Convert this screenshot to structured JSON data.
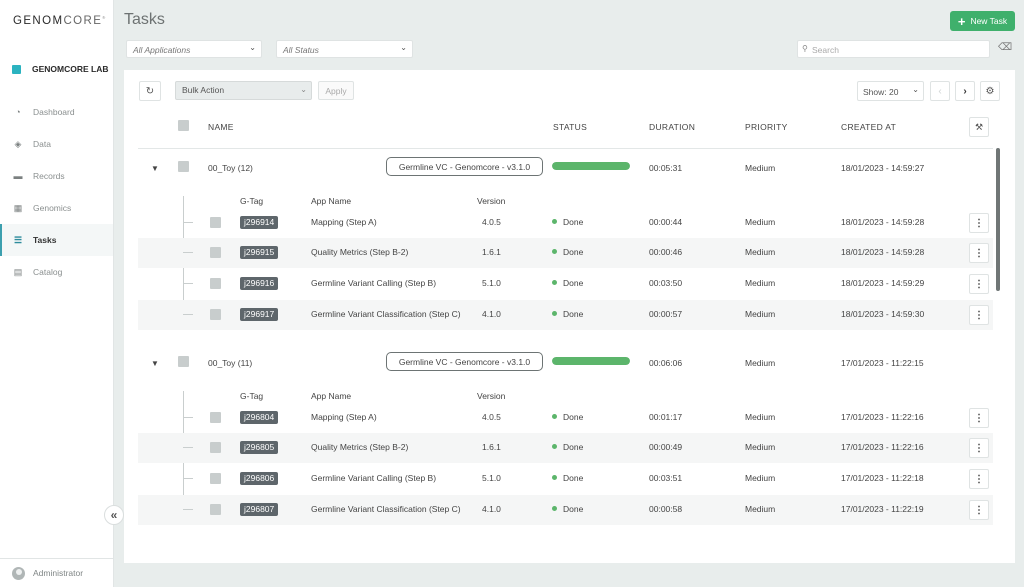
{
  "brand": {
    "logo_main": "GENOM",
    "logo_sub": "CORE",
    "logo_mark": "®",
    "lab": "GENOMCORE LAB"
  },
  "nav": [
    {
      "label": "Dashboard",
      "icon": "dashboard-icon"
    },
    {
      "label": "Data",
      "icon": "layers-icon"
    },
    {
      "label": "Records",
      "icon": "briefcase-icon"
    },
    {
      "label": "Genomics",
      "icon": "grid-icon"
    },
    {
      "label": "Tasks",
      "icon": "list-icon",
      "active": true
    },
    {
      "label": "Catalog",
      "icon": "catalog-icon"
    }
  ],
  "user": {
    "name": "Administrator"
  },
  "page": {
    "title": "Tasks",
    "new_task": "New Task"
  },
  "filters": {
    "applications": "All Applications",
    "status": "All Status",
    "search_placeholder": "Search"
  },
  "toolbar": {
    "bulk_action": "Bulk Action",
    "apply": "Apply",
    "show": "Show: 20"
  },
  "columns": {
    "name": "NAME",
    "status": "STATUS",
    "duration": "DURATION",
    "priority": "PRIORITY",
    "created_at": "CREATED AT"
  },
  "subcolumns": {
    "gtag": "G-Tag",
    "app_name": "App Name",
    "version": "Version"
  },
  "groups": [
    {
      "name": "00_Toy (12)",
      "workflow": "Germline VC - Genomcore - v3.1.0",
      "progress": 1.0,
      "duration": "00:05:31",
      "priority": "Medium",
      "created": "18/01/2023 - 14:59:27",
      "tasks": [
        {
          "tag": "j296914",
          "app": "Mapping (Step A)",
          "version": "4.0.5",
          "status": "Done",
          "duration": "00:00:44",
          "priority": "Medium",
          "created": "18/01/2023 - 14:59:28"
        },
        {
          "tag": "j296915",
          "app": "Quality Metrics (Step B-2)",
          "version": "1.6.1",
          "status": "Done",
          "duration": "00:00:46",
          "priority": "Medium",
          "created": "18/01/2023 - 14:59:28"
        },
        {
          "tag": "j296916",
          "app": "Germline Variant Calling (Step B)",
          "version": "5.1.0",
          "status": "Done",
          "duration": "00:03:50",
          "priority": "Medium",
          "created": "18/01/2023 - 14:59:29"
        },
        {
          "tag": "j296917",
          "app": "Germline Variant Classification (Step C)",
          "version": "4.1.0",
          "status": "Done",
          "duration": "00:00:57",
          "priority": "Medium",
          "created": "18/01/2023 - 14:59:30"
        }
      ]
    },
    {
      "name": "00_Toy (11)",
      "workflow": "Germline VC - Genomcore - v3.1.0",
      "progress": 1.0,
      "duration": "00:06:06",
      "priority": "Medium",
      "created": "17/01/2023 - 11:22:15",
      "tasks": [
        {
          "tag": "j296804",
          "app": "Mapping (Step A)",
          "version": "4.0.5",
          "status": "Done",
          "duration": "00:01:17",
          "priority": "Medium",
          "created": "17/01/2023 - 11:22:16"
        },
        {
          "tag": "j296805",
          "app": "Quality Metrics (Step B-2)",
          "version": "1.6.1",
          "status": "Done",
          "duration": "00:00:49",
          "priority": "Medium",
          "created": "17/01/2023 - 11:22:16"
        },
        {
          "tag": "j296806",
          "app": "Germline Variant Calling (Step B)",
          "version": "5.1.0",
          "status": "Done",
          "duration": "00:03:51",
          "priority": "Medium",
          "created": "17/01/2023 - 11:22:18"
        },
        {
          "tag": "j296807",
          "app": "Germline Variant Classification (Step C)",
          "version": "4.1.0",
          "status": "Done",
          "duration": "00:00:58",
          "priority": "Medium",
          "created": "17/01/2023 - 11:22:19"
        }
      ]
    }
  ],
  "colors": {
    "accent": "#3fb06c",
    "teal": "#2bb3c0",
    "tag_bg": "#5e666b"
  }
}
